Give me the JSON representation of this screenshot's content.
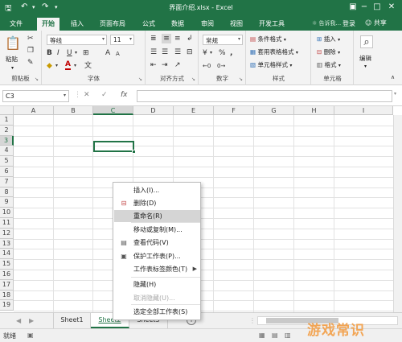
{
  "window": {
    "title": "界面介绍.xlsx - Excel",
    "quick_access": [
      "save-icon",
      "undo-icon",
      "redo-icon",
      "customize-icon"
    ]
  },
  "tabs": {
    "file": "文件",
    "home": "开始",
    "insert": "插入",
    "page_layout": "页面布局",
    "formulas": "公式",
    "data": "数据",
    "review": "审阅",
    "view": "视图",
    "developer": "开发工具",
    "tell_me": "告诉我...",
    "login": "登录",
    "share": "共享"
  },
  "ribbon": {
    "clipboard": {
      "label": "剪贴板",
      "paste": "粘贴"
    },
    "font": {
      "label": "字体",
      "font_name": "等线",
      "font_size": "11",
      "bold": "B",
      "italic": "I",
      "underline": "U",
      "grow": "A",
      "shrink": "A",
      "font_color": "A"
    },
    "alignment": {
      "label": "对齐方式"
    },
    "number": {
      "label": "数字",
      "format": "常规",
      "percent": "%",
      "comma": ","
    },
    "styles": {
      "label": "样式",
      "conditional": "条件格式",
      "table": "套用表格格式",
      "cell_styles": "单元格样式"
    },
    "cells": {
      "label": "单元格",
      "insert": "插入",
      "delete": "删除",
      "format": "格式"
    },
    "editing": {
      "label": "编辑"
    }
  },
  "formula_bar": {
    "name_box": "C3",
    "fx": "fx",
    "cancel": "✕",
    "confirm": "✓"
  },
  "grid": {
    "columns": [
      "A",
      "B",
      "C",
      "D",
      "E",
      "F",
      "G",
      "H",
      "I"
    ],
    "rows": [
      "1",
      "2",
      "3",
      "4",
      "5",
      "6",
      "7",
      "8",
      "9",
      "10",
      "11",
      "12",
      "13",
      "14",
      "15",
      "16",
      "17",
      "18",
      "19"
    ],
    "active_cell": "C3"
  },
  "sheets": {
    "tabs": [
      "Sheet1",
      "Sheet2",
      "Sheet3"
    ],
    "active": "Sheet2",
    "add": "+"
  },
  "status": {
    "ready": "就绪"
  },
  "context_menu": {
    "items": [
      {
        "label": "插入(I)...",
        "icon": "",
        "disabled": false,
        "highlighted": false
      },
      {
        "label": "删除(D)",
        "icon": "delete-sheet-icon",
        "disabled": false,
        "highlighted": false
      },
      {
        "label": "重命名(R)",
        "icon": "",
        "disabled": false,
        "highlighted": true
      },
      {
        "label": "移动或复制(M)...",
        "icon": "",
        "disabled": false,
        "highlighted": false
      },
      {
        "label": "查看代码(V)",
        "icon": "view-code-icon",
        "disabled": false,
        "highlighted": false
      },
      {
        "label": "保护工作表(P)...",
        "icon": "protect-sheet-icon",
        "disabled": false,
        "highlighted": false
      },
      {
        "label": "工作表标签颜色(T)",
        "icon": "",
        "disabled": false,
        "highlighted": false,
        "submenu": true
      },
      {
        "label": "隐藏(H)",
        "icon": "",
        "disabled": false,
        "highlighted": false
      },
      {
        "label": "取消隐藏(U)...",
        "icon": "",
        "disabled": true,
        "highlighted": false
      },
      {
        "label": "选定全部工作表(S)",
        "icon": "",
        "disabled": false,
        "highlighted": false
      }
    ]
  },
  "watermark": "游戏常识",
  "colors": {
    "accent": "#217346",
    "menu_highlight": "#d5d5d5",
    "watermark": "#f3a24d"
  }
}
